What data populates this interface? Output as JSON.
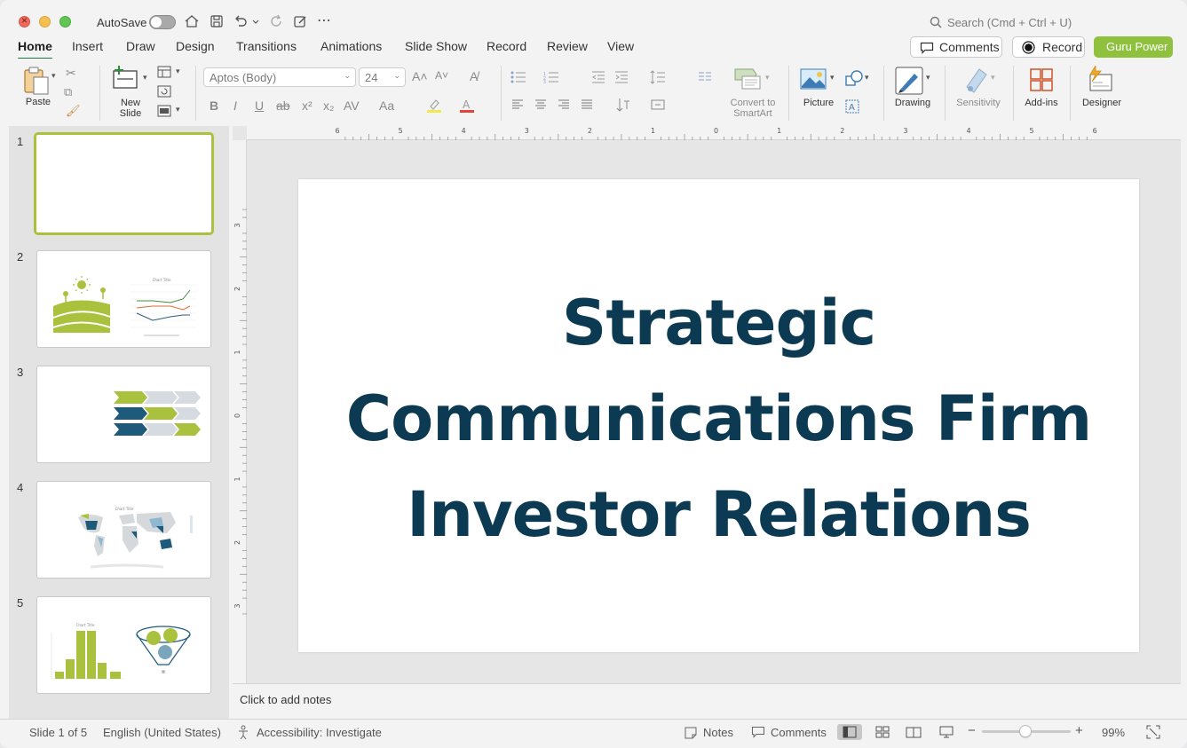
{
  "titlebar": {
    "autosave_label": "AutoSave",
    "search_placeholder": "Search (Cmd + Ctrl + U)"
  },
  "tabs": [
    "Home",
    "Insert",
    "Draw",
    "Design",
    "Transitions",
    "Animations",
    "Slide Show",
    "Record",
    "Review",
    "View"
  ],
  "active_tab": "Home",
  "header_buttons": {
    "comments": "Comments",
    "record": "Record",
    "guru": "Guru Power"
  },
  "ribbon": {
    "paste": "Paste",
    "new_slide": "New\nSlide",
    "font_name": "Aptos (Body)",
    "font_size": "24",
    "convert_smartart": "Convert to\nSmartArt",
    "picture": "Picture",
    "drawing": "Drawing",
    "sensitivity": "Sensitivity",
    "add_ins": "Add-ins",
    "designer": "Designer"
  },
  "slides": [
    {
      "number": "1"
    },
    {
      "number": "2"
    },
    {
      "number": "3"
    },
    {
      "number": "4"
    },
    {
      "number": "5"
    }
  ],
  "slide": {
    "title_line1": "Strategic",
    "title_line2": "Communications Firm",
    "title_line3": "Investor Relations",
    "title_color": "#0b3a52"
  },
  "ruler": {
    "h_labels": [
      "6",
      "5",
      "4",
      "3",
      "2",
      "1",
      "0",
      "1",
      "2",
      "3",
      "4",
      "5",
      "6"
    ],
    "v_labels": [
      "3",
      "2",
      "1",
      "0",
      "1",
      "2",
      "3"
    ]
  },
  "notes_placeholder": "Click to add notes",
  "status": {
    "slide_counter": "Slide 1 of 5",
    "language": "English (United States)",
    "accessibility": "Accessibility: Investigate",
    "notes": "Notes",
    "comments": "Comments",
    "zoom": "99%"
  },
  "colors": {
    "accent_green": "#8fc13f",
    "active_tab_underline": "#1e7145",
    "selected_thumb_border": "#a9c13c"
  }
}
